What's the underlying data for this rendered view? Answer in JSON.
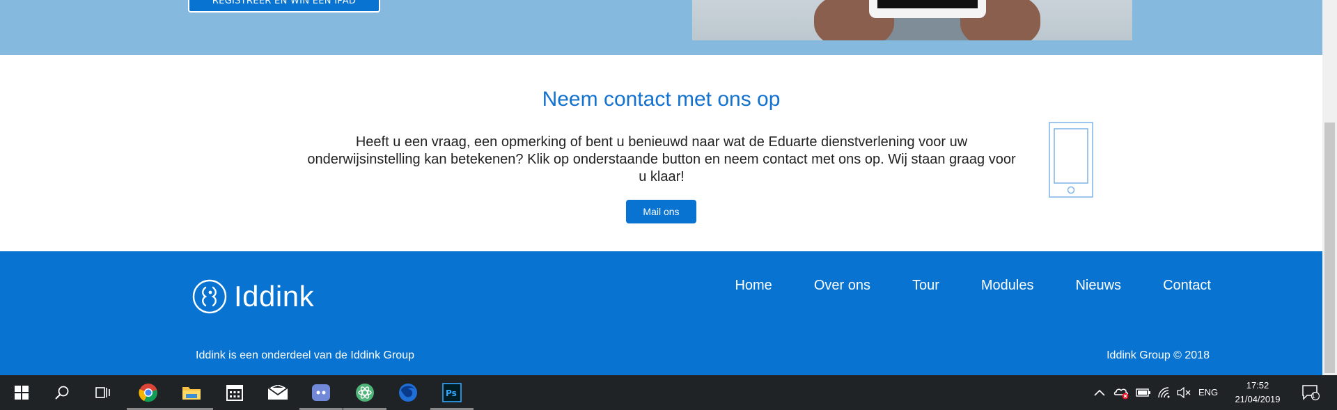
{
  "hero": {
    "button_label": "REGISTREER EN WIN EEN IPAD"
  },
  "contact": {
    "title": "Neem contact met ons op",
    "line1": "Heeft u een vraag, een opmerking of bent u benieuwd naar wat de Eduarte dienstverlening voor uw",
    "line2": "onderwijsinstelling kan betekenen? Klik op onderstaande button en neem contact met ons op. Wij staan graag voor",
    "line3": "u klaar!",
    "button_label": "Mail ons",
    "phone_icon": "smartphone-outline-icon"
  },
  "footer": {
    "logo_text": "Iddink",
    "nav": [
      "Home",
      "Over ons",
      "Tour",
      "Modules",
      "Nieuws",
      "Contact"
    ],
    "left_text": "Iddink is een onderdeel van de Iddink Group",
    "right_text": "Iddink Group © 2018"
  },
  "taskbar": {
    "apps": [
      "start-icon",
      "search-icon",
      "task-view-icon",
      "chrome-icon",
      "file-explorer-icon",
      "calendar-icon",
      "mail-icon",
      "discord-icon",
      "atom-icon",
      "firefox-icon",
      "photoshop-icon"
    ],
    "language": "ENG",
    "time": "17:52",
    "date": "21/04/2019",
    "notification_count": "1"
  },
  "colors": {
    "brand_blue": "#0873d0",
    "hero_bg": "#86b9de",
    "title_blue": "#1472cf",
    "taskbar_bg": "#1f2326"
  }
}
